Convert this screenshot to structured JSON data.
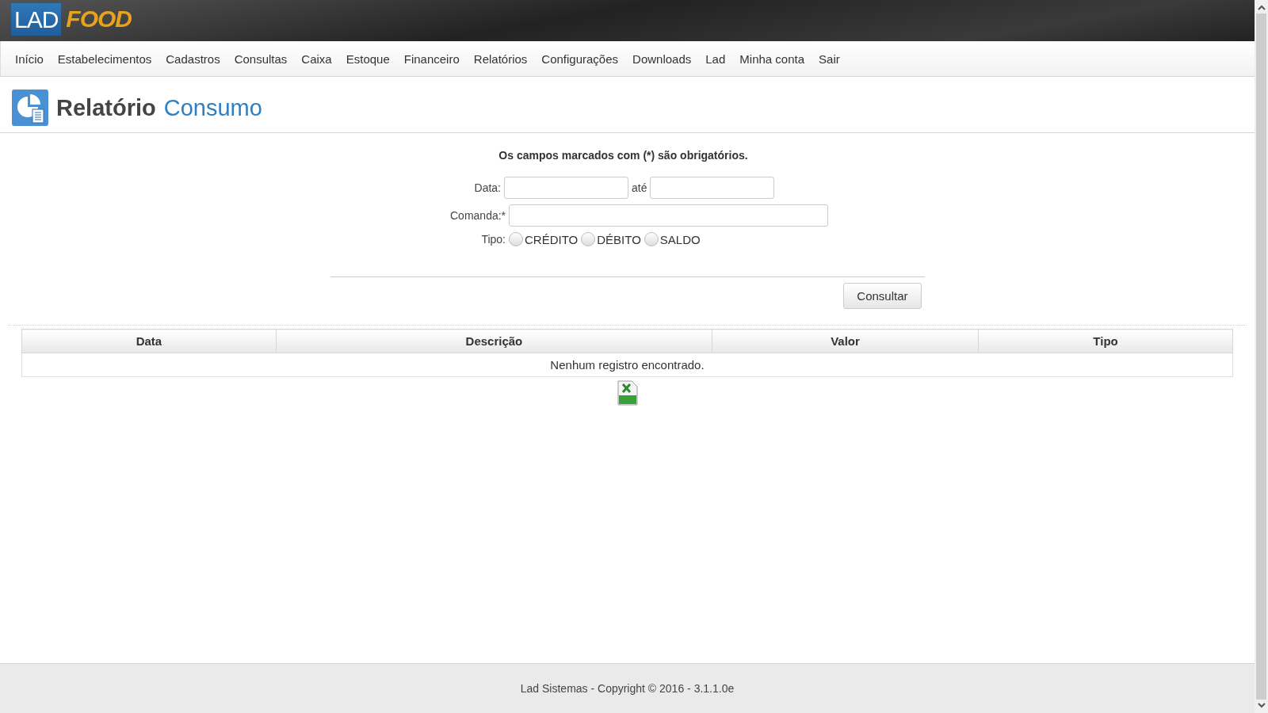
{
  "header": {
    "logo": {
      "part_1": "LAD",
      "part_2": "FOOD"
    }
  },
  "nav": {
    "items": [
      {
        "label": "Início"
      },
      {
        "label": "Estabelecimentos"
      },
      {
        "label": "Cadastros"
      },
      {
        "label": "Consultas"
      },
      {
        "label": "Caixa"
      },
      {
        "label": "Estoque"
      },
      {
        "label": "Financeiro"
      },
      {
        "label": "Relatórios"
      },
      {
        "label": "Configurações"
      },
      {
        "label": "Downloads"
      },
      {
        "label": "Lad"
      },
      {
        "label": "Minha conta"
      },
      {
        "label": "Sair"
      }
    ]
  },
  "page_title": {
    "prefix": "Relatório",
    "name": "Consumo"
  },
  "form": {
    "notice": "Os campos marcados com (*) são obrigatórios.",
    "date": {
      "label": "Data:",
      "separator": "até"
    },
    "comanda": {
      "label": "Comanda:*"
    },
    "tipo": {
      "label": "Tipo:",
      "options": [
        {
          "label": "CRÉDITO",
          "selected": false
        },
        {
          "label": "DÉBITO",
          "selected": false
        },
        {
          "label": "SALDO",
          "selected": false
        }
      ]
    },
    "submit": "Consultar"
  },
  "table": {
    "columns": [
      "Data",
      "Descrição",
      "Valor",
      "Tipo"
    ],
    "empty_message": "Nenhum registro encontrado."
  },
  "footer": "Lad Sistemas - Copyright © 2016 - 3.1.1.0e"
}
